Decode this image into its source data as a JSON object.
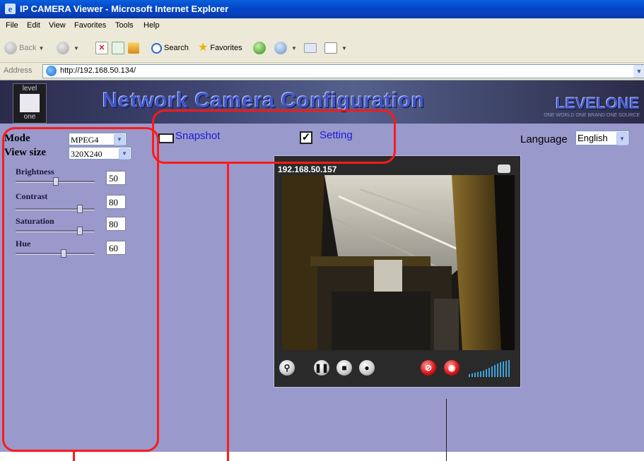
{
  "window": {
    "title": "IP CAMERA Viewer - Microsoft Internet Explorer"
  },
  "menu": [
    "File",
    "Edit",
    "View",
    "Favorites",
    "Tools",
    "Help"
  ],
  "toolbar": {
    "back_label": "Back",
    "search_label": "Search",
    "favorites_label": "Favorites"
  },
  "address": {
    "label": "Address",
    "url": "http://192.168.50.134/"
  },
  "banner": {
    "logo_top": "level",
    "logo_bottom": "one",
    "title": "Network Camera Configuration",
    "brand": "LEVELONE",
    "slogan": "ONE WORLD ONE BRAND ONE SOURCE"
  },
  "controls": {
    "mode_label": "Mode",
    "mode_value": "MPEG4",
    "viewsize_label": "View size",
    "viewsize_value": "320X240",
    "sliders": [
      {
        "label": "Brightness",
        "value": "50",
        "fraction": 0.5
      },
      {
        "label": "Contrast",
        "value": "80",
        "fraction": 0.8
      },
      {
        "label": "Saturation",
        "value": "80",
        "fraction": 0.8
      },
      {
        "label": "Hue",
        "value": "60",
        "fraction": 0.6
      }
    ]
  },
  "actions": {
    "snapshot_label": "Snapshot",
    "setting_label": "Setting"
  },
  "language": {
    "label": "Language",
    "value": "English"
  },
  "video": {
    "ip": "192.168.50.157"
  },
  "colors": {
    "page_background": "#9999cc",
    "annotation": "#ff1a1a",
    "link": "#1b1bd6"
  }
}
